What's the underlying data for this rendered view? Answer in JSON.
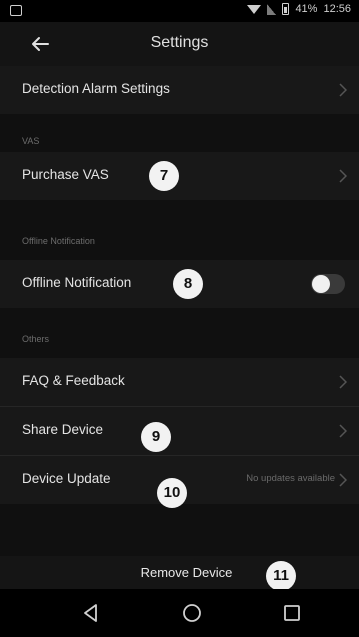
{
  "status_bar": {
    "time": "12:56",
    "battery": "41%"
  },
  "header": {
    "title": "Settings",
    "back_icon": "arrow-left-icon"
  },
  "rows": {
    "detection_alarm": "Detection Alarm Settings",
    "purchase_vas": "Purchase VAS",
    "offline_notification": "Offline Notification",
    "faq_feedback": "FAQ & Feedback",
    "share_device": "Share Device",
    "device_update": "Device Update",
    "device_update_value": "No updates available",
    "remove_device": "Remove Device"
  },
  "sections": {
    "vas": "VAS",
    "offline": "Offline Notification",
    "others": "Others"
  },
  "toggles": {
    "offline_notification_on": false
  },
  "badges": [
    "7",
    "8",
    "9",
    "10",
    "11"
  ],
  "icons": {
    "chevron": "chevron-right-icon",
    "nav": [
      "back-triangle-icon",
      "home-circle-icon",
      "recents-square-icon"
    ]
  }
}
